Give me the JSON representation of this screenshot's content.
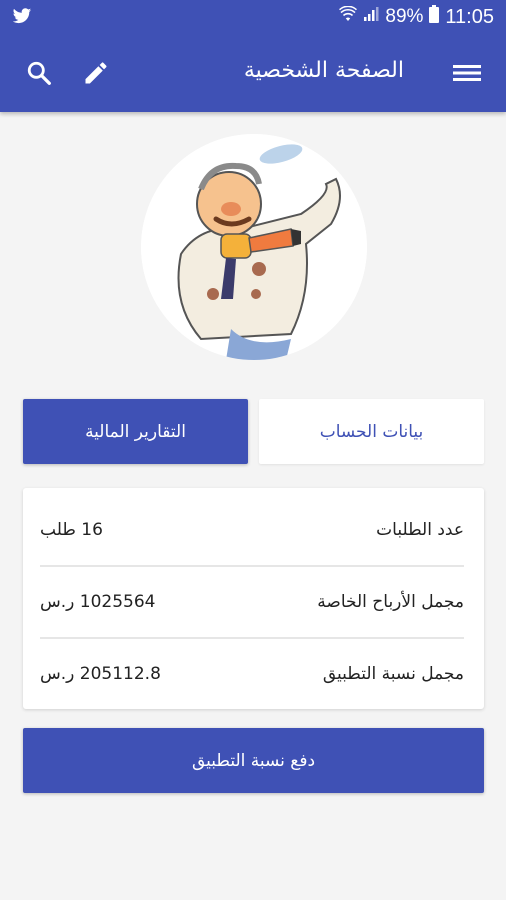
{
  "status_bar": {
    "battery_percent": "89%",
    "time": "11:05"
  },
  "toolbar": {
    "title": "الصفحة الشخصية"
  },
  "tabs": {
    "active_label": "التقارير المالية",
    "inactive_label": "بيانات الحساب"
  },
  "stats": [
    {
      "label": "عدد الطلبات",
      "value": "16 طلب"
    },
    {
      "label": "مجمل الأرباح الخاصة",
      "value": "1025564 ر.س"
    },
    {
      "label": "مجمل نسبة التطبيق",
      "value": "205112.8 ر.س"
    }
  ],
  "actions": {
    "pay_label": "دفع نسبة التطبيق"
  },
  "colors": {
    "primary": "#3f51b5",
    "background": "#f4f4f4",
    "card": "#ffffff"
  },
  "icons": [
    "twitter-icon",
    "wifi-icon",
    "signal-icon",
    "battery-icon",
    "search-icon",
    "edit-icon",
    "menu-icon"
  ]
}
